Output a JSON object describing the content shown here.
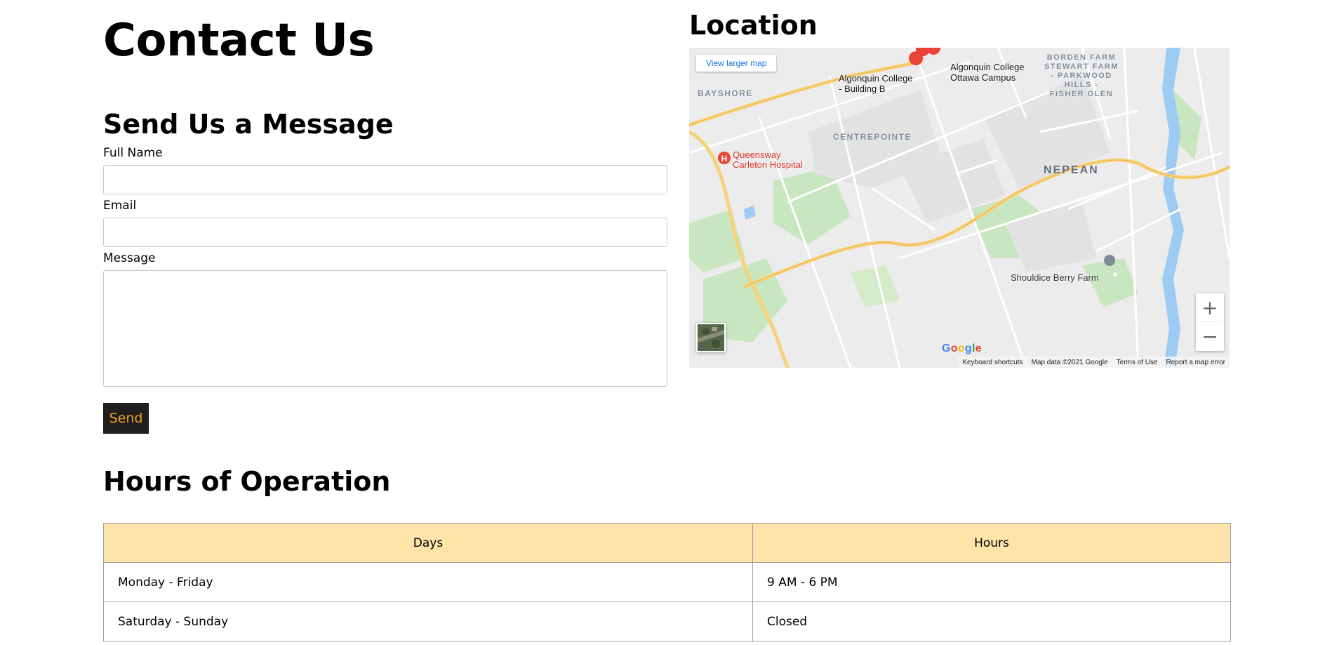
{
  "page": {
    "title": "Contact Us"
  },
  "form": {
    "heading": "Send Us a Message",
    "full_name": {
      "label": "Full Name",
      "value": "",
      "placeholder": ""
    },
    "email": {
      "label": "Email",
      "value": "",
      "placeholder": ""
    },
    "message": {
      "label": "Message",
      "value": "",
      "placeholder": ""
    },
    "send_label": "Send"
  },
  "location": {
    "heading": "Location",
    "map": {
      "view_larger_label": "View larger map",
      "labels": {
        "college_building_b": "Algonquin College\n- Building B",
        "college_campus": "Algonquin College\nOttawa Campus",
        "bayshore": "BAYSHORE",
        "centrepointe": "CENTREPOINTE",
        "nepean": "NEPEAN",
        "borden_farm": "BORDEN FARM\nSTEWART FARM\n- PARKWOOD\nHILLS -\nFISHER GLEN",
        "hospital": "Queensway\nCarleton Hospital",
        "farm": "Shouldice Berry Farm"
      },
      "zoom_in": "+",
      "zoom_out": "−",
      "google": "Google",
      "footer": {
        "shortcuts": "Keyboard shortcuts",
        "map_data": "Map data ©2021 Google",
        "terms": "Terms of Use",
        "report": "Report a map error"
      },
      "colors": {
        "land": "#ececec",
        "park": "#c8e6c0",
        "highway": "#f8d27a",
        "road": "#ffffff",
        "water": "#9ccbf3",
        "marker": "#ea4335"
      }
    }
  },
  "hours": {
    "heading": "Hours of Operation",
    "columns": [
      "Days",
      "Hours"
    ],
    "rows": [
      {
        "days": "Monday - Friday",
        "hours": "9 AM - 6 PM"
      },
      {
        "days": "Saturday - Sunday",
        "hours": "Closed"
      }
    ],
    "header_color": "#fee4a9"
  }
}
